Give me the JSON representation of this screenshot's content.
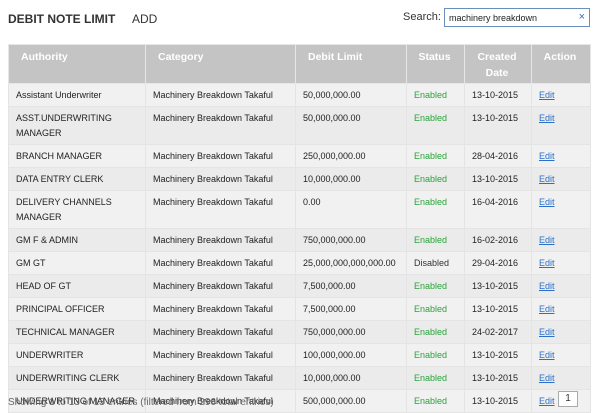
{
  "header": {
    "title": "DEBIT NOTE LIMIT",
    "add_label": "ADD",
    "search_label": "Search:",
    "search_value": "machinery breakdown",
    "clear_icon": "×"
  },
  "table": {
    "columns": [
      "Authority",
      "Category",
      "Debit Limit",
      "Status",
      "Created Date",
      "Action"
    ],
    "rows": [
      {
        "authority": "Assistant Underwriter",
        "category": "Machinery Breakdown Takaful",
        "limit": "50,000,000.00",
        "status": "Enabled",
        "date": "13-10-2015",
        "action": "Edit"
      },
      {
        "authority": "ASST.UNDERWRITING MANAGER",
        "category": "Machinery Breakdown Takaful",
        "limit": "50,000,000.00",
        "status": "Enabled",
        "date": "13-10-2015",
        "action": "Edit"
      },
      {
        "authority": "BRANCH MANAGER",
        "category": "Machinery Breakdown Takaful",
        "limit": "250,000,000.00",
        "status": "Enabled",
        "date": "28-04-2016",
        "action": "Edit"
      },
      {
        "authority": "DATA ENTRY CLERK",
        "category": "Machinery Breakdown Takaful",
        "limit": "10,000,000.00",
        "status": "Enabled",
        "date": "13-10-2015",
        "action": "Edit"
      },
      {
        "authority": "DELIVERY CHANNELS MANAGER",
        "category": "Machinery Breakdown Takaful",
        "limit": "0.00",
        "status": "Enabled",
        "date": "16-04-2016",
        "action": "Edit"
      },
      {
        "authority": "GM F & ADMIN",
        "category": "Machinery Breakdown Takaful",
        "limit": "750,000,000.00",
        "status": "Enabled",
        "date": "16-02-2016",
        "action": "Edit"
      },
      {
        "authority": "GM GT",
        "category": "Machinery Breakdown Takaful",
        "limit": "25,000,000,000,000.00",
        "status": "Disabled",
        "date": "29-04-2016",
        "action": "Edit"
      },
      {
        "authority": "HEAD OF GT",
        "category": "Machinery Breakdown Takaful",
        "limit": "7,500,000.00",
        "status": "Enabled",
        "date": "13-10-2015",
        "action": "Edit"
      },
      {
        "authority": "PRINCIPAL OFFICER",
        "category": "Machinery Breakdown Takaful",
        "limit": "7,500,000.00",
        "status": "Enabled",
        "date": "13-10-2015",
        "action": "Edit"
      },
      {
        "authority": "TECHNICAL MANAGER",
        "category": "Machinery Breakdown Takaful",
        "limit": "750,000,000.00",
        "status": "Enabled",
        "date": "24-02-2017",
        "action": "Edit"
      },
      {
        "authority": "UNDERWRITER",
        "category": "Machinery Breakdown Takaful",
        "limit": "100,000,000.00",
        "status": "Enabled",
        "date": "13-10-2015",
        "action": "Edit"
      },
      {
        "authority": "UNDERWRITING CLERK",
        "category": "Machinery Breakdown Takaful",
        "limit": "10,000,000.00",
        "status": "Enabled",
        "date": "13-10-2015",
        "action": "Edit"
      },
      {
        "authority": "UNDERWRITING MANAGER",
        "category": "Machinery Breakdown Takaful",
        "limit": "500,000,000.00",
        "status": "Enabled",
        "date": "13-10-2015",
        "action": "Edit"
      }
    ]
  },
  "footer": {
    "info": "Showing 1 to 13 of 13 entries (filtered from 296 total entries)",
    "page": "1"
  }
}
